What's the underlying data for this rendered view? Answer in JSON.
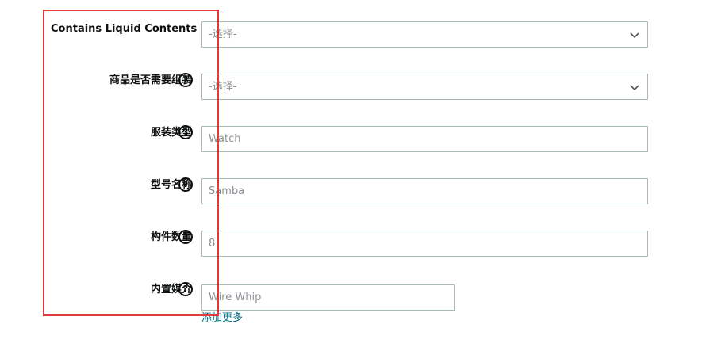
{
  "form": {
    "rows": [
      {
        "label": "Contains Liquid Contents",
        "value": "-选择-",
        "kind": "select",
        "help": false
      },
      {
        "label": "商品是否需要组装",
        "value": "-选择-",
        "kind": "select",
        "help": true
      },
      {
        "label": "服装类型",
        "value": "Watch",
        "kind": "text",
        "help": true
      },
      {
        "label": "型号名称",
        "value": "Samba",
        "kind": "text",
        "help": true
      },
      {
        "label": "构件数量",
        "value": "8",
        "kind": "text",
        "help": true
      },
      {
        "label": "内置媒介",
        "value": "Wire Whip",
        "kind": "text",
        "help": true
      }
    ],
    "help_glyph": "?",
    "add_more_label": "添加更多"
  },
  "colors": {
    "accent_link": "#007185",
    "highlight_border": "#e53935",
    "field_border": "#aab7b8",
    "placeholder_text": "#8d9096"
  },
  "icons": {
    "select_chevron": "chevron-down-icon",
    "help": "question-circle-icon"
  }
}
